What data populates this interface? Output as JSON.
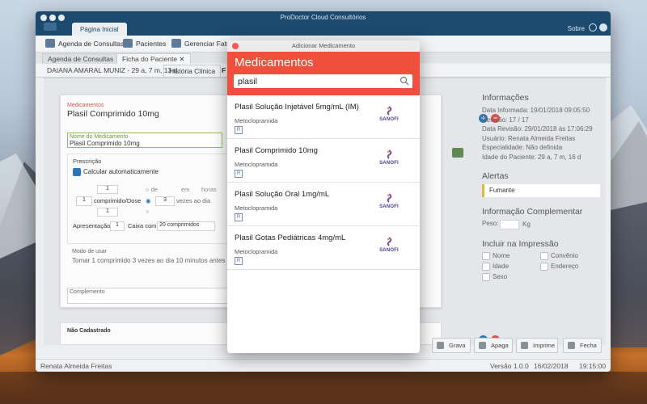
{
  "window": {
    "title": "ProDoctor Cloud Consultórios",
    "home_tab": "Página Inicial",
    "sobre": "Sobre"
  },
  "toolbar": {
    "agenda": "Agenda de Consultas",
    "pacientes": "Pacientes",
    "gerenciar": "Gerenciar Fatur"
  },
  "doc_tabs": [
    "Agenda de Consultas",
    "Ficha do Paciente"
  ],
  "patient": {
    "info": "DAIANA AMARAL MUNIZ - 29 a, 7 m, 13 d",
    "tab_historia": "História Clínica",
    "tab_f": "F"
  },
  "form": {
    "medicamentos_label": "Medicamentos",
    "medication_title": "Plasil Comprimido 10mg",
    "nome_label": "Nome do Medicamento",
    "nome_value": "Plasil Comprimido 10mg",
    "prescricao": "Prescrição",
    "calcular": "Calcular automaticamente",
    "qty_top": "1",
    "qty": "1",
    "unit": "comprimido/Dose",
    "qty_bottom": "1",
    "de": "de",
    "em": "em",
    "horas": "horas",
    "vezes_value": "3",
    "vezes_label": "vezes ao dia",
    "apresentacao_label": "Apresentação:",
    "apresentacao_value": "1",
    "caixa_label": "Caixa com",
    "caixa_value": "20 comprimidos",
    "modo_label": "Modo de usar",
    "modo_text": "Tomar 1 comprimido 3 vezes ao dia 10 minutos antes das",
    "complemento_label": "Complemento",
    "nao_cadastrado": "Não Cadastrado"
  },
  "info_panel": {
    "title": "Informações",
    "rows": [
      {
        "label": "Data Informada:",
        "value": "19/01/2018 09:05:50"
      },
      {
        "label": "Revisão:",
        "value": "17 / 17"
      },
      {
        "label": "Data Revisão:",
        "value": "29/01/2018 às 17:06:29"
      },
      {
        "label": "Usuário:",
        "value": "Renata Almeida Freitas"
      },
      {
        "label": "Especialidade:",
        "value": "Não definida"
      },
      {
        "label": "Idade do Paciente:",
        "value": "29 a, 7 m, 16 d"
      }
    ],
    "alertas_title": "Alertas",
    "alerta": "Fumante",
    "complementar_title": "Informação Complementar",
    "peso_label": "Peso:",
    "peso_unit": "Kg",
    "impressao_title": "Incluir na Impressão",
    "impressao_left": [
      "Nome",
      "Idade",
      "Sexo"
    ],
    "impressao_right": [
      "Convênio",
      "Endereço"
    ]
  },
  "bottom_buttons": [
    "Grava",
    "Apaga",
    "Imprime",
    "Fecha"
  ],
  "status": {
    "user": "Renata Almeida Freitas",
    "version": "Versão 1.0.0",
    "date": "16/02/2018",
    "time": "19:15:00"
  },
  "modal": {
    "window_title": "Adicionar Medicamento",
    "heading": "Medicamentos",
    "search_value": "plasil",
    "results": [
      {
        "name": "Plasil Solução Injetável 5mg/mL (IM)",
        "substance": "Metoclopramida",
        "badge": "R",
        "lab": "SANOFI"
      },
      {
        "name": "Plasil Comprimido 10mg",
        "substance": "Metoclopramida",
        "badge": "R",
        "lab": "SANOFI"
      },
      {
        "name": "Plasil Solução Oral 1mg/mL",
        "substance": "Metoclopramida",
        "badge": "R",
        "lab": "SANOFI"
      },
      {
        "name": "Plasil Gotas Pediátricas 4mg/mL",
        "substance": "Metoclopramida",
        "badge": "R",
        "lab": "SANOFI"
      }
    ]
  },
  "colors": {
    "titlebar": "#1c4a6e",
    "modal_header": "#f04f3e",
    "alert_bar": "#e0b83a"
  }
}
